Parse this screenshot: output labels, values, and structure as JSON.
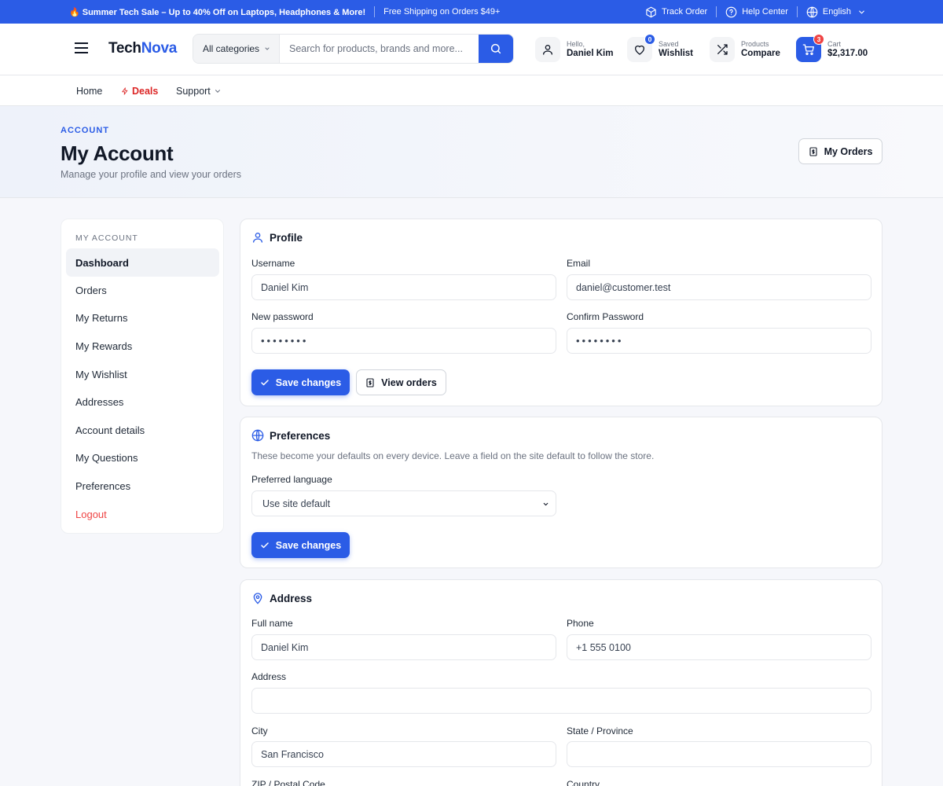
{
  "promo": {
    "sale_text": "🔥 Summer Tech Sale – Up to 40% Off on Laptops, Headphones & More!",
    "shipping_text": "Free Shipping on Orders $49+",
    "track_order": "Track Order",
    "help_center": "Help Center",
    "language": "English"
  },
  "header": {
    "logo_part1": "Tech",
    "logo_part2": "Nova",
    "category": "All categories",
    "search_placeholder": "Search for products, brands and more...",
    "account_greeting": "Hello,",
    "account_name": "Daniel Kim",
    "wishlist_small": "Saved",
    "wishlist_big": "Wishlist",
    "wishlist_count": "0",
    "compare_small": "Products",
    "compare_big": "Compare",
    "cart_small": "Cart",
    "cart_total": "$2,317.00",
    "cart_count": "3"
  },
  "nav": {
    "home": "Home",
    "deals": "Deals",
    "support": "Support"
  },
  "hero": {
    "eyebrow": "ACCOUNT",
    "title": "My Account",
    "subtitle": "Manage your profile and view your orders",
    "my_orders": "My Orders"
  },
  "sidebar": {
    "heading": "MY ACCOUNT",
    "items": [
      {
        "label": "Dashboard"
      },
      {
        "label": "Orders"
      },
      {
        "label": "My Returns"
      },
      {
        "label": "My Rewards"
      },
      {
        "label": "My Wishlist"
      },
      {
        "label": "Addresses"
      },
      {
        "label": "Account details"
      },
      {
        "label": "My Questions"
      },
      {
        "label": "Preferences"
      },
      {
        "label": "Logout"
      }
    ]
  },
  "profile": {
    "title": "Profile",
    "username_label": "Username",
    "username_value": "Daniel Kim",
    "email_label": "Email",
    "email_value": "daniel@customer.test",
    "new_password_label": "New password",
    "new_password_value": "••••••••",
    "confirm_password_label": "Confirm Password",
    "confirm_password_value": "••••••••",
    "save_label": "Save changes",
    "view_orders_label": "View orders"
  },
  "preferences": {
    "title": "Preferences",
    "note": "These become your defaults on every device. Leave a field on the site default to follow the store.",
    "language_label": "Preferred language",
    "language_value": "Use site default",
    "save_label": "Save changes"
  },
  "address": {
    "title": "Address",
    "fullname_label": "Full name",
    "fullname_value": "Daniel Kim",
    "phone_label": "Phone",
    "phone_value": "+1 555 0100",
    "address_label": "Address",
    "address_value": "",
    "city_label": "City",
    "city_value": "San Francisco",
    "state_label": "State / Province",
    "state_value": "",
    "zip_label": "ZIP / Postal Code",
    "country_label": "Country"
  },
  "colors": {
    "primary": "#2b5ce6",
    "danger": "#ef4444",
    "deals": "#dc2626"
  }
}
